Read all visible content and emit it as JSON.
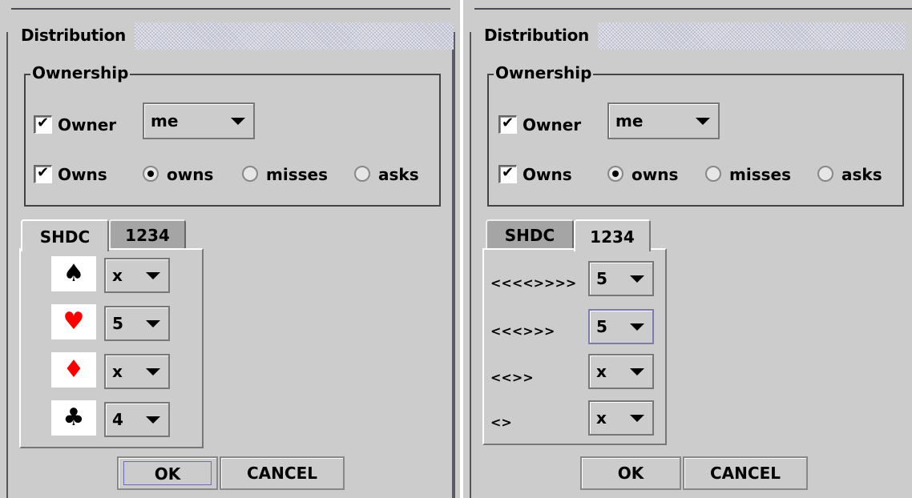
{
  "dialogs": [
    {
      "title": "Distribution",
      "ownership": {
        "legend": "Ownership",
        "owner_label": "Owner",
        "owner_checked": true,
        "owner_value": "me",
        "owns_label": "Owns",
        "owns_checked": true,
        "radios": [
          "owns",
          "misses",
          "asks"
        ],
        "selected": "owns"
      },
      "tabs": [
        "SHDC",
        "1234"
      ],
      "active_tab": "SHDC",
      "suit_rows": [
        {
          "suit": "spade",
          "glyph": "♠",
          "color": "#000000",
          "value": "x"
        },
        {
          "suit": "heart",
          "glyph": "♥",
          "color": "#ff0000",
          "value": "5"
        },
        {
          "suit": "diamond",
          "glyph": "♦",
          "color": "#ff0000",
          "value": "x"
        },
        {
          "suit": "club",
          "glyph": "♣",
          "color": "#000000",
          "value": "4"
        }
      ],
      "buttons": {
        "ok": "OK",
        "cancel": "CANCEL"
      }
    },
    {
      "title": "Distribution",
      "ownership": {
        "legend": "Ownership",
        "owner_label": "Owner",
        "owner_checked": true,
        "owner_value": "me",
        "owns_label": "Owns",
        "owns_checked": true,
        "radios": [
          "owns",
          "misses",
          "asks"
        ],
        "selected": "owns"
      },
      "tabs": [
        "SHDC",
        "1234"
      ],
      "active_tab": "1234",
      "pattern_rows": [
        {
          "pattern": "<<<<>>>>",
          "value": "5"
        },
        {
          "pattern": "<<<>>>",
          "value": "5"
        },
        {
          "pattern": "<<>>",
          "value": "x"
        },
        {
          "pattern": "<>",
          "value": "x"
        }
      ],
      "buttons": {
        "ok": "OK",
        "cancel": "CANCEL"
      }
    }
  ]
}
